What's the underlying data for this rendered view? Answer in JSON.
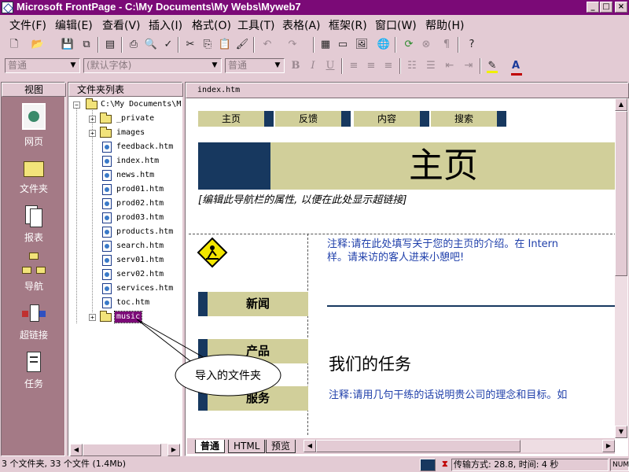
{
  "app": {
    "title": "Microsoft FrontPage - C:\\My Documents\\My Webs\\Myweb7",
    "window_buttons": [
      "_",
      "□",
      "×"
    ]
  },
  "menu": [
    "文件(F)",
    "编辑(E)",
    "查看(V)",
    "插入(I)",
    "格式(O)",
    "工具(T)",
    "表格(A)",
    "框架(R)",
    "窗口(W)",
    "帮助(H)"
  ],
  "format_toolbar": {
    "style": "普通",
    "font": "(默认字体)",
    "size": "普通",
    "bold": "B",
    "italic": "I",
    "underline": "U",
    "font_color_letter": "A"
  },
  "views": {
    "header": "视图",
    "items": [
      "网页",
      "文件夹",
      "报表",
      "导航",
      "超链接",
      "任务"
    ]
  },
  "folders": {
    "header": "文件夹列表",
    "root": "C:\\My Documents\\M",
    "items": [
      {
        "name": "_private",
        "type": "folder"
      },
      {
        "name": "images",
        "type": "folder"
      },
      {
        "name": "feedback.htm",
        "type": "file"
      },
      {
        "name": "index.htm",
        "type": "file"
      },
      {
        "name": "news.htm",
        "type": "file"
      },
      {
        "name": "prod01.htm",
        "type": "file"
      },
      {
        "name": "prod02.htm",
        "type": "file"
      },
      {
        "name": "prod03.htm",
        "type": "file"
      },
      {
        "name": "products.htm",
        "type": "file"
      },
      {
        "name": "search.htm",
        "type": "file"
      },
      {
        "name": "serv01.htm",
        "type": "file"
      },
      {
        "name": "serv02.htm",
        "type": "file"
      },
      {
        "name": "services.htm",
        "type": "file"
      },
      {
        "name": "toc.htm",
        "type": "file"
      },
      {
        "name": "music",
        "type": "folder",
        "selected": true
      }
    ]
  },
  "editor": {
    "tab": "index.htm",
    "nav_buttons": [
      "主页",
      "反馈",
      "内容",
      "搜索"
    ],
    "banner": "主页",
    "nav_note": "[编辑此导航栏的属性, 以便在此处显示超链接]",
    "intro_note_line1": "注释:请在此处填写关于您的主页的介绍。在 Intern",
    "intro_note_line2": "样。请来访的客人进来小憩吧!",
    "side_buttons": [
      "新闻",
      "产品",
      "服务"
    ],
    "mission_heading": "我们的任务",
    "mission_note": "注释:请用几句干练的话说明贵公司的理念和目标。如",
    "view_tabs": [
      "普通",
      "HTML",
      "预览"
    ]
  },
  "callout": "导入的文件夹",
  "status": {
    "left": "3 个文件夹, 33 个文件 (1.4Mb)",
    "transfer": "传输方式: 28.8, 时间: 4 秒",
    "numlock": "NUM"
  },
  "colors": {
    "title_bar": "#7b0a77",
    "nav_button": "#d1cf9a",
    "nav_square": "#17385f",
    "note_text": "#1f3faa",
    "views_panel": "#a47a86"
  }
}
